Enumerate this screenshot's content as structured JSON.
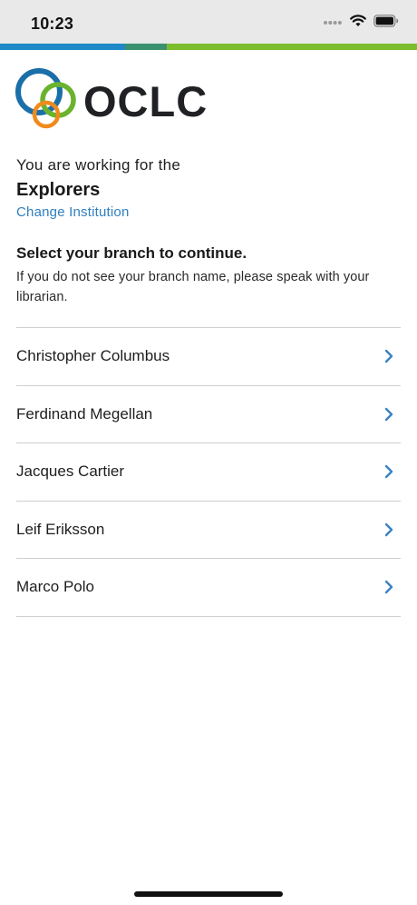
{
  "status_bar": {
    "time": "10:23",
    "icons": [
      "cellular-signal-icon",
      "wifi-icon",
      "battery-icon"
    ]
  },
  "brand": {
    "logo_text": "OCLC",
    "logo_mark": "®",
    "colors": {
      "blue": "#1e88c8",
      "teal": "#3a9170",
      "green": "#7cbd2d",
      "ring_blue": "#1b6fa9",
      "ring_green": "#6ab32e",
      "ring_orange": "#f08a1c",
      "link": "#2f7fc1",
      "chevron": "#3a82c4"
    }
  },
  "institution": {
    "intro": "You are working for the",
    "name": "Explorers",
    "change_label": "Change Institution"
  },
  "branch_section": {
    "heading": "Select your branch to continue.",
    "help_text": "If you do not see your branch name, please speak with your librarian."
  },
  "branches": [
    {
      "name": "Christopher Columbus"
    },
    {
      "name": "Ferdinand Megellan"
    },
    {
      "name": "Jacques Cartier"
    },
    {
      "name": "Leif Eriksson"
    },
    {
      "name": "Marco Polo"
    }
  ]
}
